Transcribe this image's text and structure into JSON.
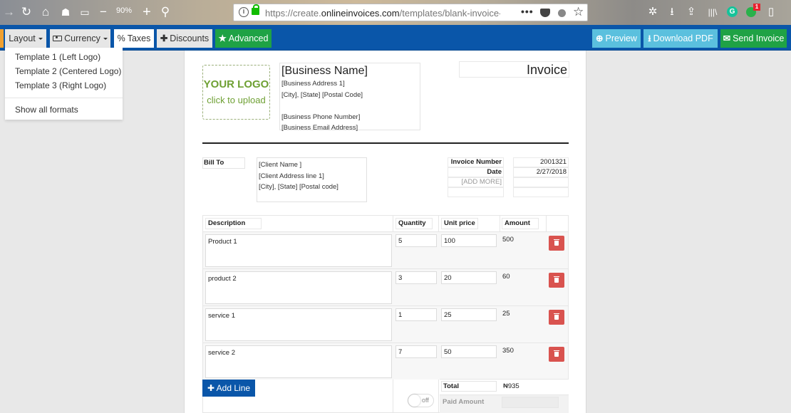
{
  "browser": {
    "zoom_level": "90%",
    "url_host_prefix": "https://create.",
    "url_host": "onlineinvoices.com",
    "url_path": "/templates/blank-invoice-temp",
    "notification_badge": "1",
    "icons": {
      "back": "→",
      "reload": "↻",
      "home": "⌂",
      "more": "•••",
      "star": "☆",
      "zoom_out": "−",
      "zoom_in": "+",
      "search": "⚲",
      "info": "i",
      "settings": "✲",
      "download": "⭳",
      "share": "⇪",
      "library": "|||\\",
      "sidebar": "▯",
      "grammarly": "G"
    }
  },
  "toolbar": {
    "layout_label": "Layout",
    "currency_label": "Currency",
    "taxes_icon": "%",
    "taxes_label": "Taxes",
    "discounts_icon": "✚",
    "discounts_label": "Discounts",
    "advanced_icon": "★",
    "advanced_label": "Advanced",
    "preview_icon": "⊕",
    "preview_label": "Preview",
    "download_icon": "⭳",
    "download_label": "Download PDF",
    "send_icon": "✉",
    "send_label": "Send Invoice",
    "colors": {
      "blue": "#0a56a9",
      "green": "#1fa245",
      "sky": "#5bc0de",
      "danger": "#d9534f"
    }
  },
  "layout_menu": {
    "items": [
      "Template 1 (Left Logo)",
      "Template 2 (Centered Logo)",
      "Template 3 (Right Logo)"
    ],
    "footer": "Show all formats"
  },
  "invoice": {
    "logo_title": "YOUR LOGO",
    "logo_sub": "click to upload",
    "business": {
      "name": "[Business Name]",
      "address1": "[Business Address 1]",
      "city_line": "[City], [State] [Postal Code]",
      "phone": "[Business Phone Number]",
      "email": "[Business Email Address]"
    },
    "title": "Invoice",
    "bill_to_label": "Bill To",
    "client": {
      "name": "[Client Name ]",
      "address1": "[Client Address line 1]",
      "city_line": "[City], [State] [Postal code]"
    },
    "meta": {
      "number_label": "Invoice Number",
      "number_value": "2001321",
      "date_label": "Date",
      "date_value": "2/27/2018",
      "add_more": "[ADD MORE]"
    },
    "columns": {
      "description": "Description",
      "quantity": "Quantity",
      "unit_price": "Unit price",
      "amount": "Amount"
    },
    "lines": [
      {
        "description": "Product 1",
        "quantity": "5",
        "unit_price": "100",
        "amount": "500"
      },
      {
        "description": "product 2",
        "quantity": "3",
        "unit_price": "20",
        "amount": "60"
      },
      {
        "description": "service 1",
        "quantity": "1",
        "unit_price": "25",
        "amount": "25"
      },
      {
        "description": "service 2",
        "quantity": "7",
        "unit_price": "50",
        "amount": "350"
      }
    ],
    "add_line_label": "✚ Add Line",
    "total_label": "Total",
    "total_value": "₦935",
    "paid_toggle": "off",
    "paid_label": "Paid Amount"
  }
}
